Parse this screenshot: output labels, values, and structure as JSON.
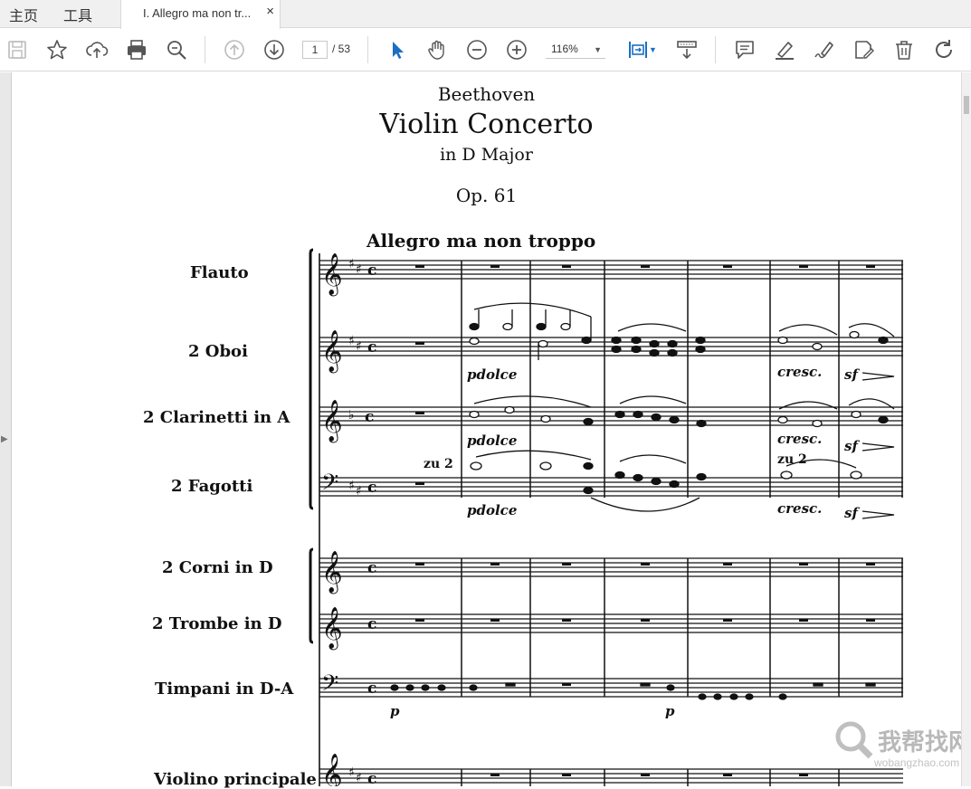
{
  "tabbar": {
    "home_label": "主页",
    "tools_label": "工具",
    "document_tab_label": "I. Allegro ma non tr...",
    "close_glyph": "×"
  },
  "toolbar": {
    "current_page": "1",
    "total_pages": "/ 53",
    "zoom_level": "116%",
    "accent_color": "#1a6fc4",
    "icons": [
      "save-icon",
      "bookmark-star-icon",
      "upload-cloud-icon",
      "print-icon",
      "search-zoom-icon",
      "prev-page-icon",
      "next-page-icon",
      "select-cursor-icon",
      "hand-tool-icon",
      "zoom-out-icon",
      "zoom-in-icon",
      "fit-page-icon",
      "scroll-mode-icon",
      "comment-icon",
      "highlight-icon",
      "sign-icon",
      "edit-pdf-icon",
      "delete-icon",
      "rotate-icon"
    ]
  },
  "document": {
    "composer": "Beethoven",
    "title": "Violin Concerto",
    "key": "in D Major",
    "opus": "Op. 61",
    "tempo": "Allegro ma non troppo",
    "instruments": [
      "Flauto",
      "2 Oboi",
      "2 Clarinetti in A",
      "2 Fagotti",
      "2 Corni in D",
      "2 Trombe in D",
      "Timpani in D-A",
      "Violino principale"
    ],
    "dynamics": {
      "pdolce": "pdolce",
      "cresc": "cresc.",
      "sf": "sf",
      "p": "p",
      "zu2": "zu 2"
    }
  },
  "watermark": {
    "text": "我帮找网",
    "url": "wobangzhao.com"
  }
}
